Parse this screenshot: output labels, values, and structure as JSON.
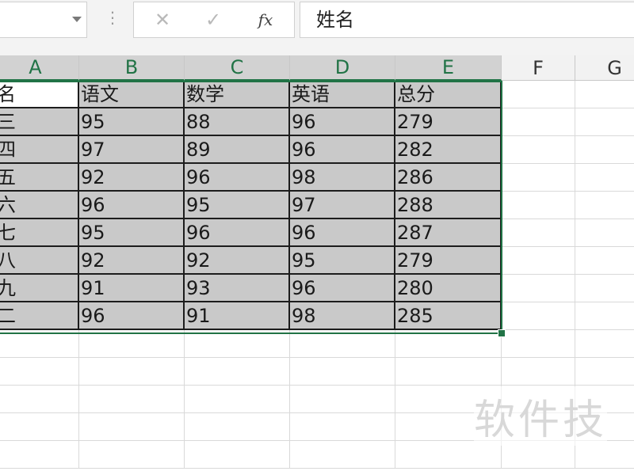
{
  "formula_bar": {
    "fx_label": "fx",
    "cancel_icon": "✕",
    "enter_icon": "✓",
    "dots": "⋮",
    "content": "姓名"
  },
  "columns": [
    "A",
    "B",
    "C",
    "D",
    "E",
    "F",
    "G"
  ],
  "headers": [
    "名",
    "语文",
    "数学",
    "英语",
    "总分"
  ],
  "rows": [
    [
      "三",
      "95",
      "88",
      "96",
      "279"
    ],
    [
      "四",
      "97",
      "89",
      "96",
      "282"
    ],
    [
      "五",
      "92",
      "96",
      "98",
      "286"
    ],
    [
      "六",
      "96",
      "95",
      "97",
      "288"
    ],
    [
      "七",
      "95",
      "96",
      "96",
      "287"
    ],
    [
      "八",
      "92",
      "92",
      "95",
      "279"
    ],
    [
      "九",
      "91",
      "93",
      "96",
      "280"
    ],
    [
      "二",
      "96",
      "91",
      "98",
      "285"
    ]
  ],
  "watermark": "软件技",
  "colors": {
    "selection_accent": "#217346",
    "selected_fill": "#c9c9c9"
  }
}
